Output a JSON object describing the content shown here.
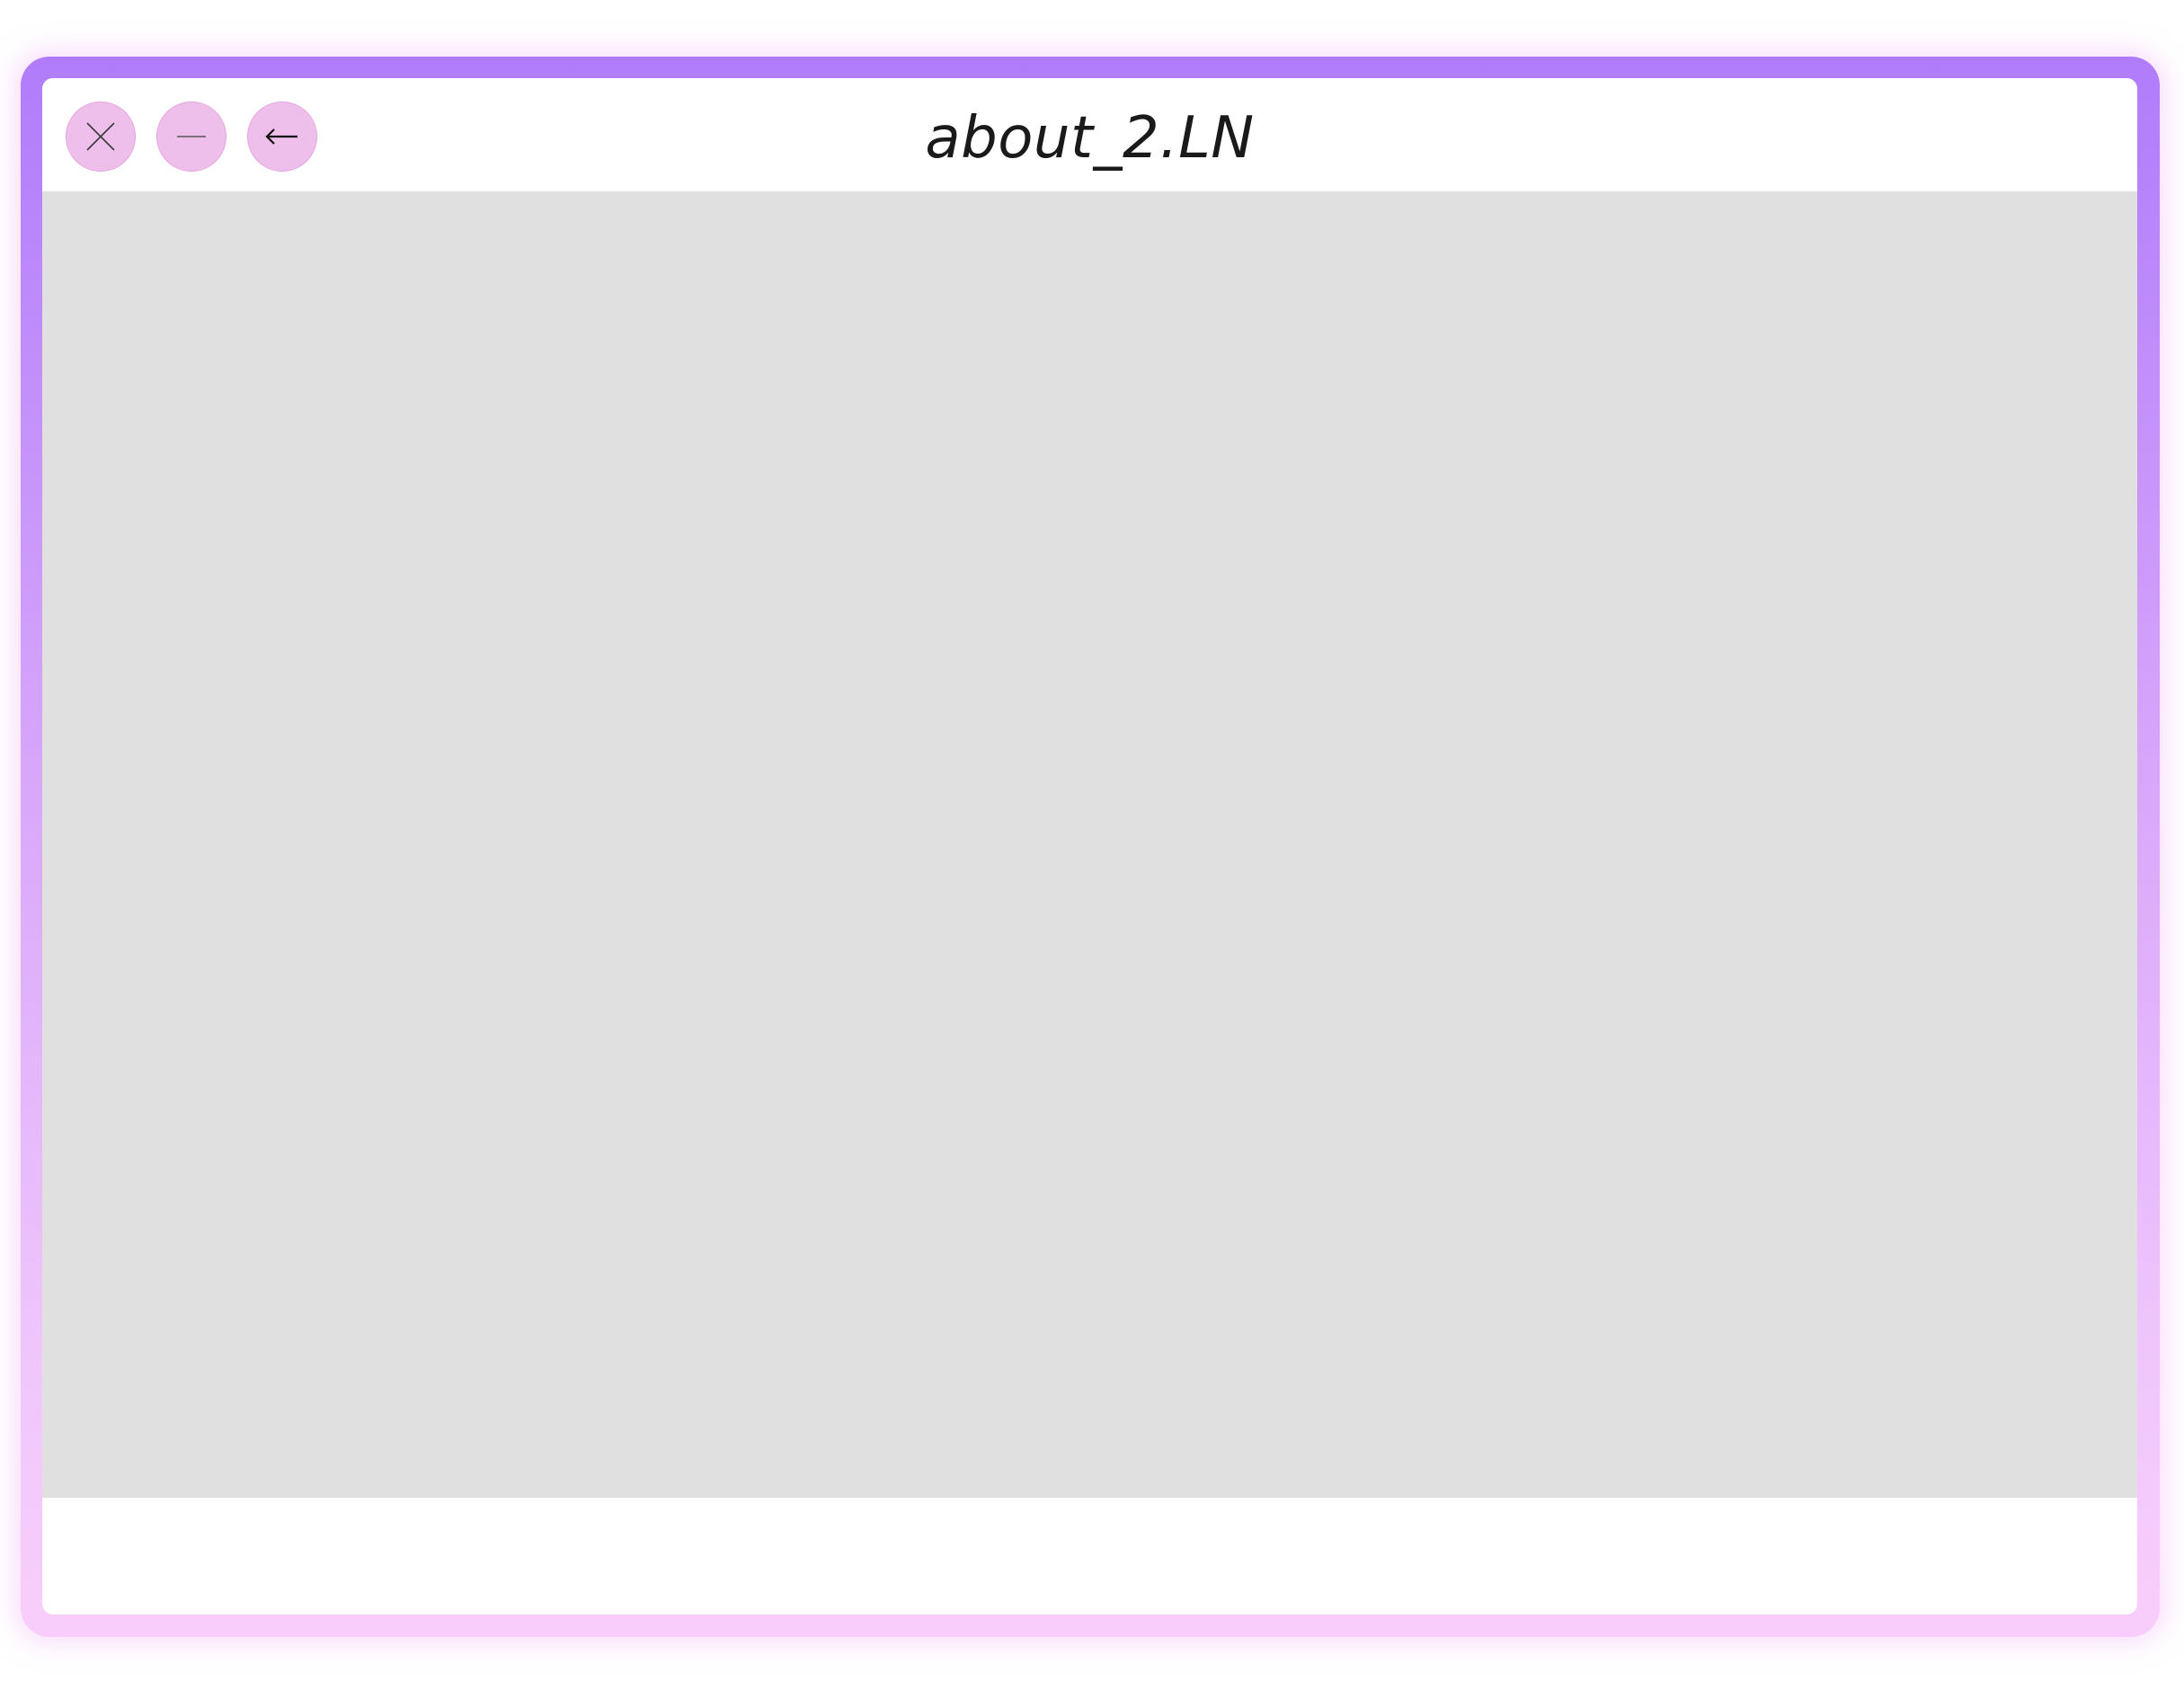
{
  "window": {
    "title": "about_2.LN",
    "controls": {
      "close": {
        "icon": "close-icon"
      },
      "minimize": {
        "icon": "minimize-icon"
      },
      "back": {
        "icon": "back-arrow-icon"
      }
    },
    "status_text": ""
  },
  "colors": {
    "frame_gradient_top": "#b07cfb",
    "frame_gradient_bottom": "#f9cdfb",
    "control_button_fill": "#eebfea",
    "content_background": "#e0e0e0"
  }
}
